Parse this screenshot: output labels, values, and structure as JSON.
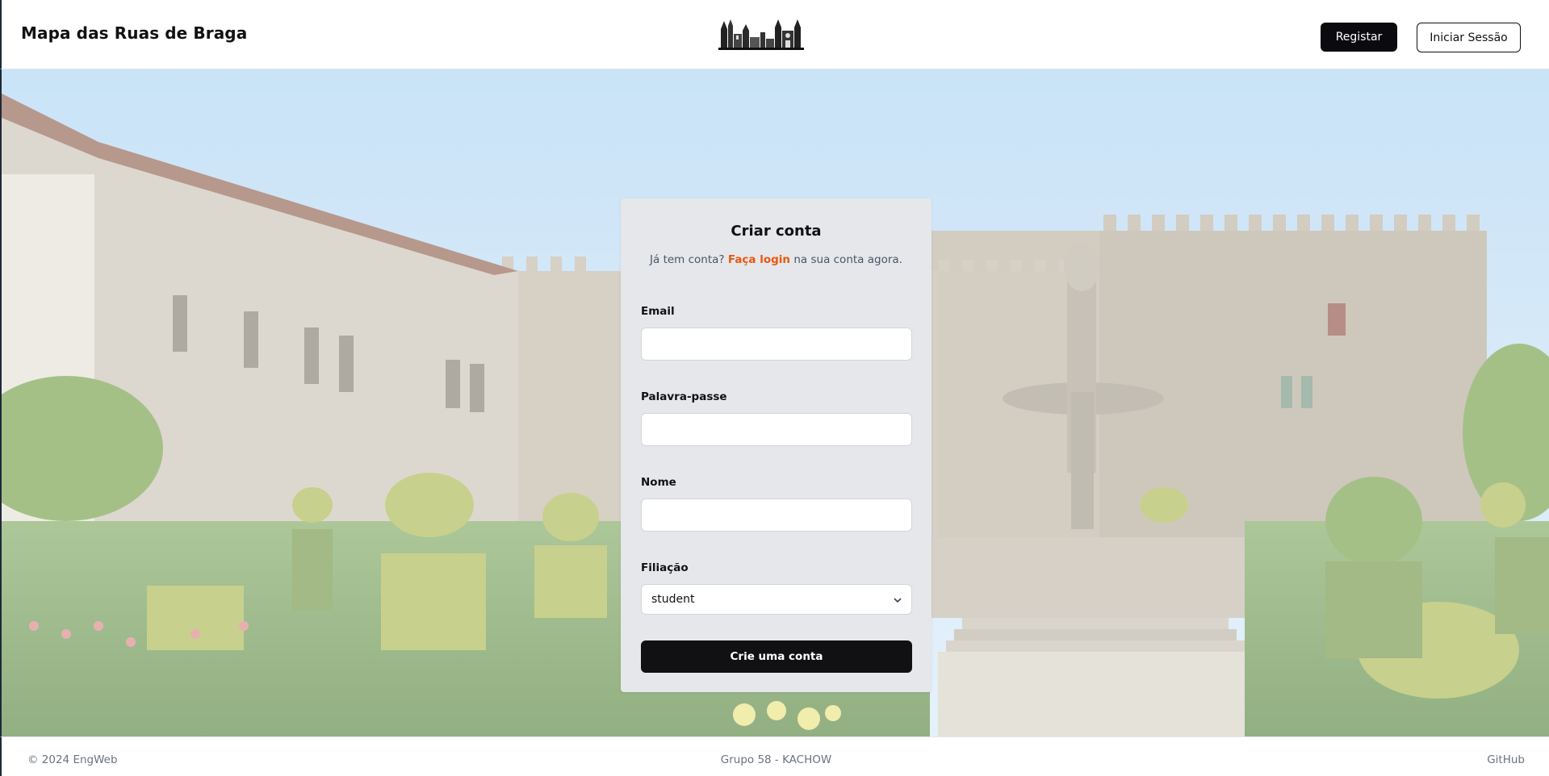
{
  "header": {
    "title": "Mapa das Ruas de Braga",
    "register_label": "Registar",
    "login_label": "Iniciar Sessão"
  },
  "form": {
    "title": "Criar conta",
    "subtitle_prefix": "Já tem conta?",
    "subtitle_link": "Faça login",
    "subtitle_suffix": "na sua conta agora.",
    "email_label": "Email",
    "email_value": "",
    "password_label": "Palavra-passe",
    "password_value": "",
    "name_label": "Nome",
    "name_value": "",
    "affiliation_label": "Filiação",
    "affiliation_value": "student",
    "submit_label": "Crie uma conta"
  },
  "footer": {
    "copyright": "© 2024 EngWeb",
    "group": "Grupo 58 - KACHOW",
    "github": "GitHub"
  },
  "colors": {
    "accent_link": "#ea580c",
    "primary_button": "#0b0b0f",
    "card_background": "#e5e7eb"
  },
  "icons": {
    "logo": "braga-skyline-logo",
    "select_chevron": "chevron-down-icon"
  }
}
